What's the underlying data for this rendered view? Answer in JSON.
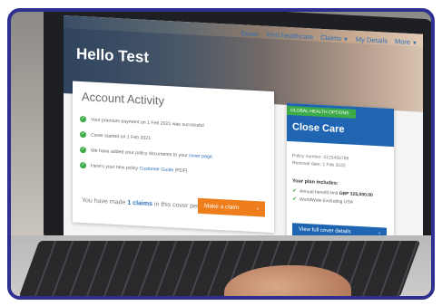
{
  "nav": {
    "items": [
      {
        "label": "Cover",
        "dropdown": false
      },
      {
        "label": "Find healthcare",
        "dropdown": false
      },
      {
        "label": "Claims",
        "dropdown": true
      },
      {
        "label": "My Details",
        "dropdown": false
      },
      {
        "label": "More",
        "dropdown": true
      }
    ]
  },
  "hero": {
    "title": "Hello Test"
  },
  "activity": {
    "title": "Account Activity",
    "items": [
      {
        "text": "Your premium payment on 1 Feb 2021 was successful",
        "link": ""
      },
      {
        "text": "Cover started on 1 Feb 2021",
        "link": ""
      },
      {
        "text": "We have added your policy documents to your ",
        "link": "cover page."
      },
      {
        "text": "Here's your new policy ",
        "link": "Customer Guide",
        "suffix": " (PDF)"
      }
    ],
    "claims_prefix": "You have made ",
    "claims_count": "1 claims",
    "claims_suffix": " in this cover period.",
    "claim_button": "Make a claim",
    "claim_button_arrow": "›"
  },
  "cover": {
    "tag": "GLOBAL HEALTH OPTIONS",
    "title": "Close Care",
    "policy_number": "Policy number: 0123456789",
    "renewal_date": "Renewal date: 1 Feb 2022",
    "plan_title": "Your plan includes:",
    "plan_items": [
      {
        "label": "Annual benefit limit ",
        "value": "GBP 325,000.00"
      },
      {
        "label": "WorldWide Excluding USA",
        "value": ""
      }
    ],
    "button": "View full cover details",
    "button_arrow": "›"
  },
  "colors": {
    "frame": "#2f2f8f",
    "link_blue": "#2d6fb6",
    "brand_blue": "#1f65b2",
    "success_green": "#3cab48",
    "cta_orange": "#ee7d1b"
  },
  "icons": {
    "activity_check": "check-circle-icon",
    "plan_check": "check-icon",
    "dropdown": "chevron-down-icon"
  }
}
